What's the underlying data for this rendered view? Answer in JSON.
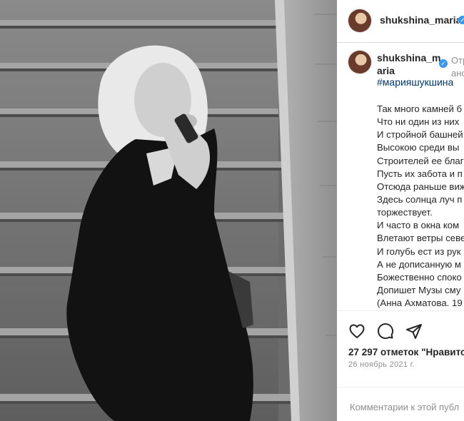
{
  "post": {
    "username": "shukshina_maria",
    "caption_username_line1": "shukshina_m",
    "caption_username_line2": "aria",
    "faded_line1": "Отр",
    "faded_line2": "ано",
    "hashtag": "#марияшукшина",
    "poem_lines": [
      "Так много камней б",
      "Что ни один из них",
      "И стройной башней",
      "Высокою среди вы",
      "Строителей ее благ",
      "Пусть их забота и п",
      "Отсюда раньше виж",
      "Здесь солнца луч п",
      "торжествует.",
      "И часто в окна ком",
      "Влетают ветры севе",
      "И голубь ест из рук",
      "А не дописанную м",
      "Божественно споко",
      "Допишет Музы сму",
      "(Анна Ахматова. 19"
    ],
    "likes": "27 297 отметок \"Нравитс",
    "date": "26 ноябрь 2021 г.",
    "comment_placeholder": "Комментарии к этой публ"
  },
  "icons": {
    "verified": "verified-badge-icon",
    "like": "heart-icon",
    "comment": "comment-bubble-icon",
    "share": "paper-plane-icon"
  },
  "colors": {
    "verified": "#3897f0",
    "hashtag": "#00376b",
    "text": "#262626",
    "muted": "#8e8e8e"
  }
}
